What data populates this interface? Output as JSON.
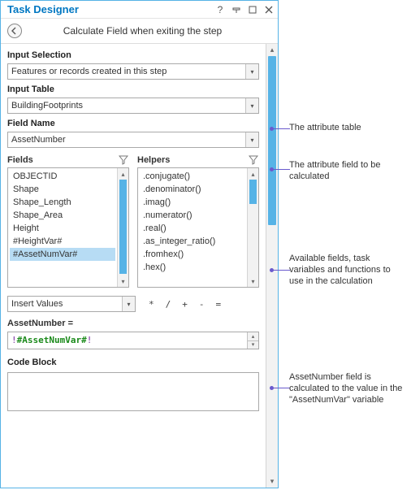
{
  "titlebar": {
    "title": "Task Designer"
  },
  "subtitle": "Calculate Field when exiting the step",
  "input_selection": {
    "label": "Input Selection",
    "value": "Features or records created in this step"
  },
  "input_table": {
    "label": "Input Table",
    "value": "BuildingFootprints"
  },
  "field_name": {
    "label": "Field Name",
    "value": "AssetNumber"
  },
  "fields": {
    "label": "Fields",
    "items": [
      "OBJECTID",
      "Shape",
      "Shape_Length",
      "Shape_Area",
      "Height",
      "#HeightVar#",
      "#AssetNumVar#"
    ],
    "selected": "#AssetNumVar#"
  },
  "helpers": {
    "label": "Helpers",
    "items": [
      ".conjugate()",
      ".denominator()",
      ".imag()",
      ".numerator()",
      ".real()",
      ".as_integer_ratio()",
      ".fromhex()",
      ".hex()"
    ]
  },
  "insert_values": {
    "value": "Insert Values"
  },
  "operators": [
    "*",
    "/",
    "+",
    "-",
    "="
  ],
  "expression": {
    "label": "AssetNumber =",
    "excl_open": "!",
    "var": "#AssetNumVar#",
    "excl_close": "!"
  },
  "code_block": {
    "label": "Code Block"
  },
  "annotations": {
    "a1": "The attribute table",
    "a2": "The attribute field to be calculated",
    "a3": "Available fields, task variables and functions to use in the calculation",
    "a4": "AssetNumber field is calculated to the value in the \"AssetNumVar\" variable"
  }
}
